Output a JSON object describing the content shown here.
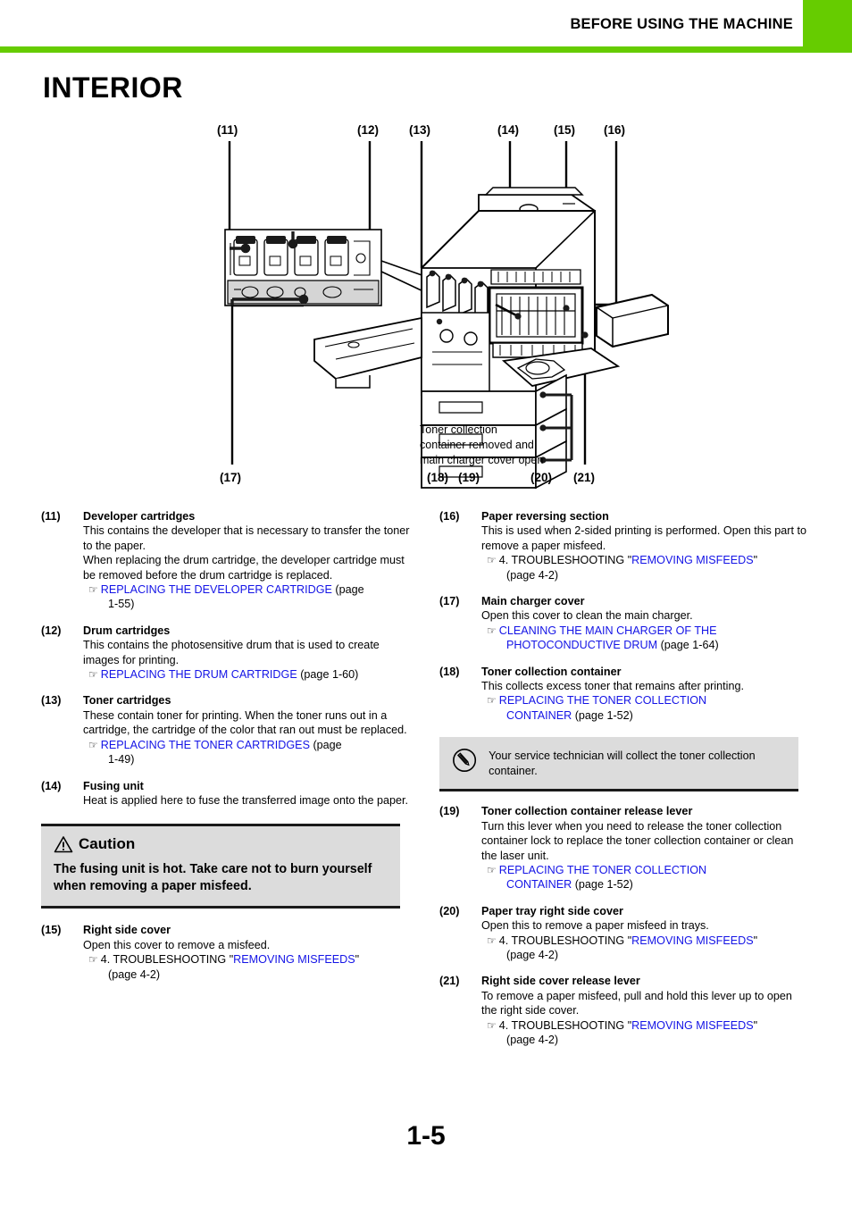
{
  "header": {
    "title": "BEFORE USING THE MACHINE",
    "accent_color": "#66cc00"
  },
  "page_title": "INTERIOR",
  "diagram": {
    "callouts_top": [
      "(11)",
      "(12)",
      "(13)",
      "(14)",
      "(15)",
      "(16)"
    ],
    "callouts_bottom": [
      "(17)",
      "(18)",
      "(19)",
      "(20)",
      "(21)"
    ],
    "inset_caption": "Toner collection container removed and main charger cover open"
  },
  "items_left": [
    {
      "num": "(11)",
      "title": "Developer cartridges",
      "body": "This contains the developer that is necessary to transfer the toner to the paper.\nWhen replacing the drum cartridge, the developer cartridge must be removed before the drum cartridge is replaced.",
      "xref_icon": "☞",
      "xref_link": "REPLACING THE DEVELOPER CARTRIDGE",
      "xref_page": " (page",
      "xref_cont": "1-55)"
    },
    {
      "num": "(12)",
      "title": "Drum cartridges",
      "body": "This contains the photosensitive drum that is used to create images for printing.",
      "xref_icon": "☞",
      "xref_link": "REPLACING THE DRUM CARTRIDGE",
      "xref_page": " (page 1-60)",
      "xref_cont": ""
    },
    {
      "num": "(13)",
      "title": "Toner cartridges",
      "body": "These contain toner for printing. When the toner runs out in a cartridge, the cartridge of the color that ran out must be replaced.",
      "xref_icon": "☞",
      "xref_link": "REPLACING THE TONER CARTRIDGES",
      "xref_page": " (page",
      "xref_cont": "1-49)"
    },
    {
      "num": "(14)",
      "title": "Fusing unit",
      "body": "Heat is applied here to fuse the transferred image onto the paper.",
      "xref_icon": "",
      "xref_link": "",
      "xref_page": "",
      "xref_cont": ""
    }
  ],
  "caution": {
    "icon": "warning-triangle-icon",
    "heading": "Caution",
    "text": "The fusing unit is hot. Take care not to burn yourself when removing a paper misfeed."
  },
  "items_left_after_caution": [
    {
      "num": "(15)",
      "title": "Right side cover",
      "body": "Open this cover to remove a misfeed.",
      "xref_icon": "☞",
      "xref_prefix": "4. TROUBLESHOOTING \"",
      "xref_link": "REMOVING MISFEEDS",
      "xref_suffix": "\"",
      "xref_cont": "(page 4-2)"
    }
  ],
  "items_right": [
    {
      "num": "(16)",
      "title": "Paper reversing section",
      "body": "This is used when 2-sided printing is performed. Open this part to remove a paper misfeed.",
      "xref_icon": "☞",
      "xref_prefix": "4. TROUBLESHOOTING \"",
      "xref_link": "REMOVING MISFEEDS",
      "xref_suffix": "\"",
      "xref_cont": "(page 4-2)"
    },
    {
      "num": "(17)",
      "title": "Main charger cover",
      "body": "Open this cover to clean the main charger.",
      "xref_icon": "☞",
      "xref_prefix": "",
      "xref_link": "CLEANING THE MAIN CHARGER OF THE",
      "xref_suffix": "",
      "xref_cont_link": "PHOTOCONDUCTIVE DRUM",
      "xref_cont_page": " (page 1-64)"
    },
    {
      "num": "(18)",
      "title": "Toner collection container",
      "body": "This collects excess toner that remains after printing.",
      "xref_icon": "☞",
      "xref_prefix": "",
      "xref_link": "REPLACING THE TONER COLLECTION",
      "xref_suffix": "",
      "xref_cont_link": "CONTAINER",
      "xref_cont_page": " (page 1-52)"
    }
  ],
  "note": {
    "icon": "pencil-note-icon",
    "text": "Your service technician will collect the toner collection container."
  },
  "items_right_after_note": [
    {
      "num": "(19)",
      "title": "Toner collection container release lever",
      "body": "Turn this lever when you need to release the toner collection container lock to replace the toner collection container or clean the laser unit.",
      "xref_icon": "☞",
      "xref_link": "REPLACING THE TONER COLLECTION",
      "xref_cont_link": "CONTAINER",
      "xref_cont_page": " (page 1-52)"
    },
    {
      "num": "(20)",
      "title": "Paper tray right side cover",
      "body": "Open this to remove a paper misfeed in trays.",
      "xref_icon": "☞",
      "xref_prefix": "4. TROUBLESHOOTING \"",
      "xref_link": "REMOVING MISFEEDS",
      "xref_suffix": "\"",
      "xref_cont": "(page 4-2)"
    },
    {
      "num": "(21)",
      "title": "Right side cover release lever",
      "body": "To remove a paper misfeed, pull and hold this lever up to open the right side cover.",
      "xref_icon": "☞",
      "xref_prefix": "4. TROUBLESHOOTING \"",
      "xref_link": "REMOVING MISFEEDS",
      "xref_suffix": "\"",
      "xref_cont": "(page 4-2)"
    }
  ],
  "page_number": "1-5",
  "colors": {
    "link": "#1414e6",
    "box_bg": "#dcdcdc",
    "accent": "#66cc00"
  }
}
